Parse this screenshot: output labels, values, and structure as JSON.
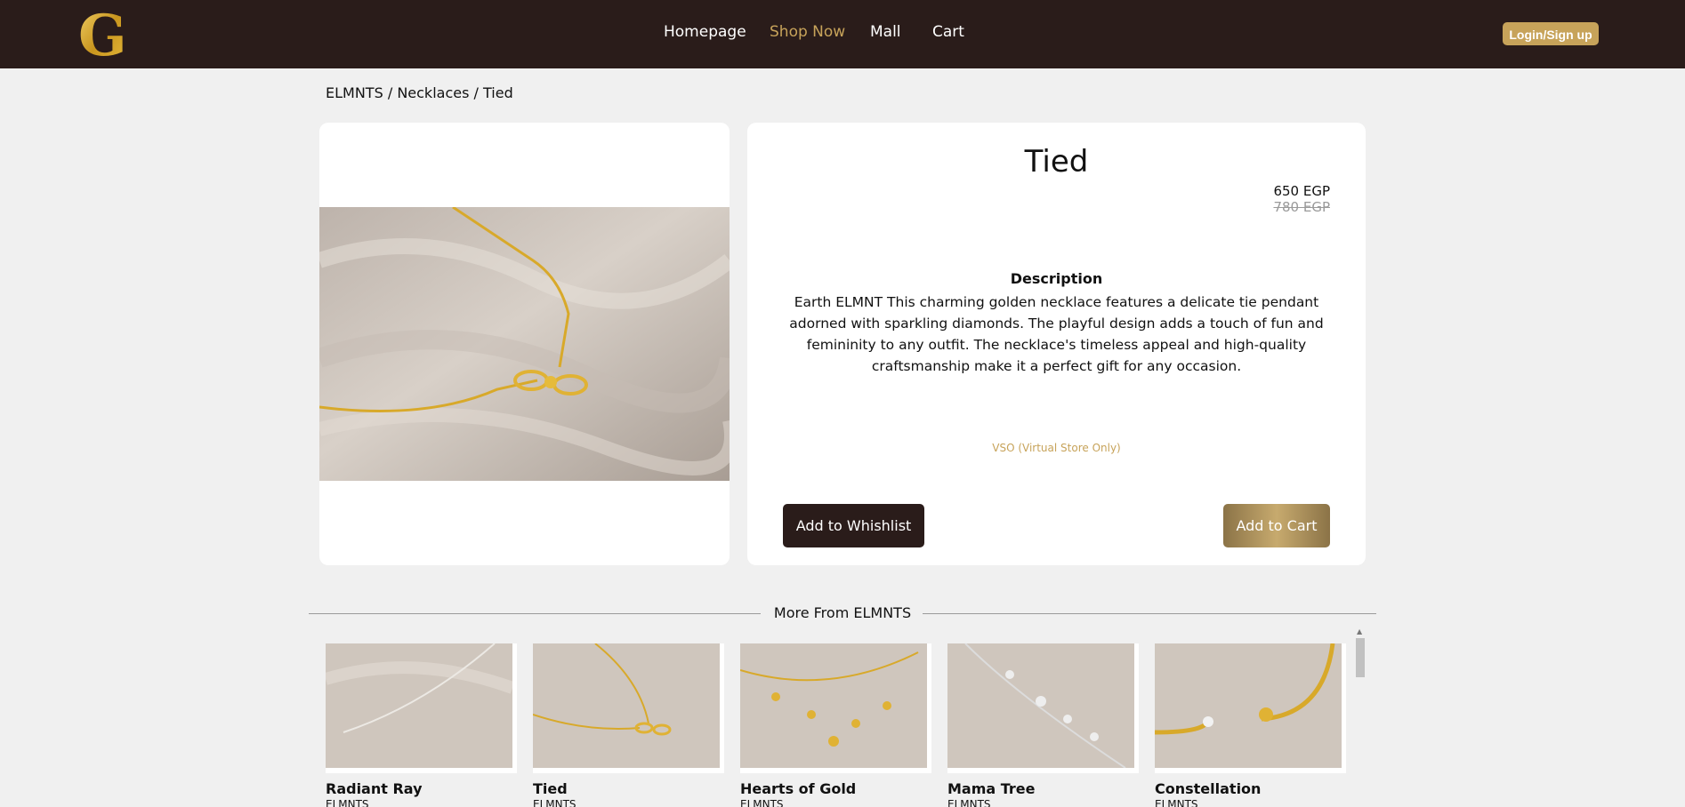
{
  "nav": {
    "links": [
      "Homepage",
      "Shop Now",
      "Mall",
      "Cart"
    ],
    "active": "Shop Now",
    "login_label": "Login/Sign up"
  },
  "breadcrumb": [
    "ELMNTS",
    "Necklaces",
    "Tied"
  ],
  "product": {
    "title": "Tied",
    "price": "650 EGP",
    "old_price": "780 EGP",
    "description_heading": "Description",
    "description": "Earth ELMNT This charming golden necklace features a delicate tie pendant adorned with sparkling diamonds. The playful design adds a touch of fun and femininity to any outfit. The necklace's timeless appeal and high-quality craftsmanship make it a perfect gift for any occasion.",
    "availability_note": "VSO (Virtual Store Only)",
    "wishlist_label": "Add to Whishlist",
    "cart_label": "Add to Cart"
  },
  "more": {
    "heading": "More From ELMNTS",
    "items": [
      {
        "name": "Radiant Ray",
        "brand": "ELMNTS"
      },
      {
        "name": "Tied",
        "brand": "ELMNTS"
      },
      {
        "name": "Hearts of Gold",
        "brand": "ELMNTS"
      },
      {
        "name": "Mama Tree",
        "brand": "ELMNTS"
      },
      {
        "name": "Constellation",
        "brand": "ELMNTS"
      }
    ]
  },
  "colors": {
    "nav_bg": "#2a1c1a",
    "accent_gold": "#c7a35a",
    "page_bg": "#f0f0f0"
  }
}
